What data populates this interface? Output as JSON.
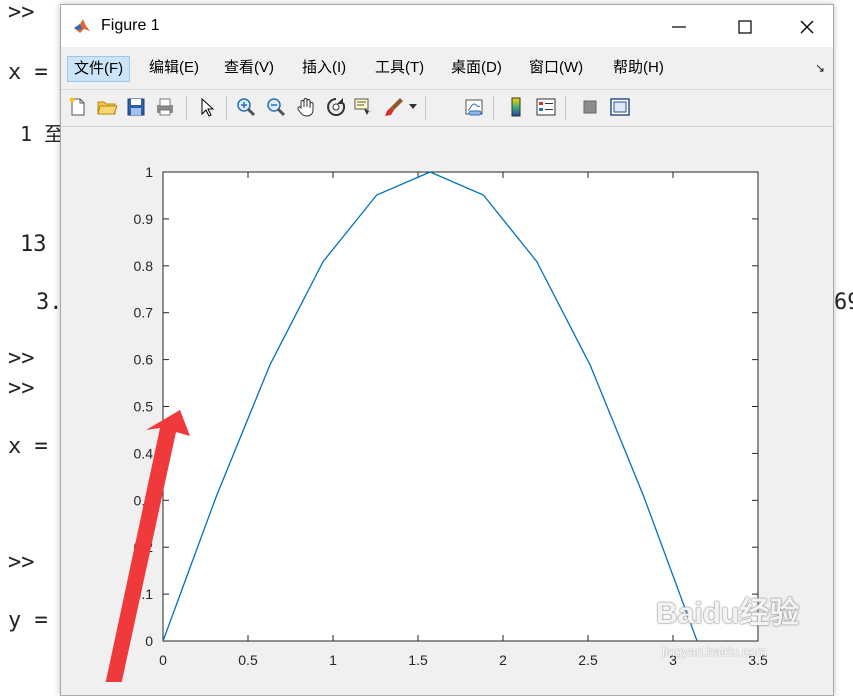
{
  "console": {
    "lines": [
      ">>",
      "x =",
      "1 至",
      "13",
      "3.",
      ">>",
      ">>",
      "x =",
      ">>",
      "y =",
      "69"
    ]
  },
  "window": {
    "title": "Figure 1",
    "menu": [
      "文件(F)",
      "编辑(E)",
      "查看(V)",
      "插入(I)",
      "工具(T)",
      "桌面(D)",
      "窗口(W)",
      "帮助(H)"
    ],
    "menu_overflow": "↘"
  },
  "toolbar": {
    "icons": [
      "new-figure-icon",
      "open-file-icon",
      "save-icon",
      "print-icon",
      "edit-plot-icon",
      "zoom-in-icon",
      "zoom-out-icon",
      "pan-icon",
      "rotate-3d-icon",
      "data-cursor-icon",
      "brush-icon",
      "link-plot-icon",
      "colorbar-icon",
      "legend-icon",
      "hide-plot-tools-icon",
      "show-plot-tools-icon"
    ]
  },
  "chart_data": {
    "type": "line",
    "x": [
      0,
      0.314,
      0.628,
      0.942,
      1.257,
      1.571,
      1.885,
      2.199,
      2.513,
      2.827,
      3.142
    ],
    "series": [
      {
        "values": [
          0,
          0.309,
          0.588,
          0.809,
          0.951,
          1.0,
          0.951,
          0.809,
          0.588,
          0.309,
          0
        ]
      }
    ],
    "xlim": [
      0,
      3.5
    ],
    "ylim": [
      0,
      1
    ],
    "xticks": [
      "0",
      "0.5",
      "1",
      "1.5",
      "2",
      "2.5",
      "3",
      "3.5"
    ],
    "yticks": [
      "0",
      "0.1",
      "0.2",
      "0.3",
      "0.4",
      "0.5",
      "0.6",
      "0.7",
      "0.8",
      "0.9",
      "1"
    ],
    "line_color": "#0072bd",
    "grid": false
  },
  "annotation": {
    "arrow_color": "#f0393b"
  },
  "watermark": {
    "logo": "Baidu经验",
    "sub": "jingyan.baidu.com"
  }
}
